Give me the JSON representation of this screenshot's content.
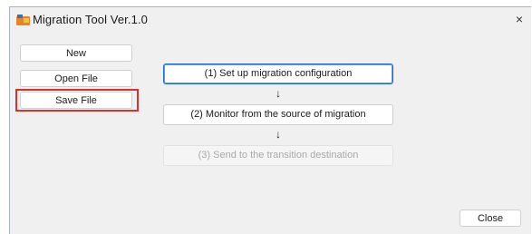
{
  "window": {
    "title": "Migration Tool Ver.1.0",
    "close_glyph": "×"
  },
  "sidebar": {
    "new_label": "New",
    "open_label": "Open File",
    "save_label": "Save File"
  },
  "steps": {
    "step1_label": "(1) Set up migration configuration",
    "arrow1": "↓",
    "step2_label": "(2) Monitor from the source of migration",
    "arrow2": "↓",
    "step3_label": "(3) Send to the transition destination"
  },
  "footer": {
    "close_label": "Close"
  },
  "colors": {
    "highlight": "#d93030",
    "primary_border": "#1e6fd0"
  },
  "icons": {
    "app": "app-logo-icon",
    "close": "close-icon"
  }
}
